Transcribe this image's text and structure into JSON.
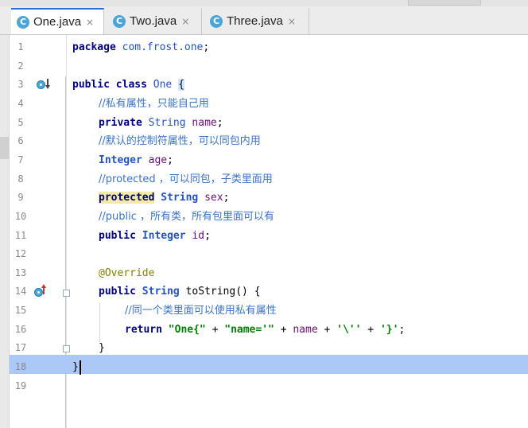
{
  "tabs": [
    {
      "label": "One.java",
      "close": "×"
    },
    {
      "label": "Two.java",
      "close": "×"
    },
    {
      "label": "Three.java",
      "close": "×"
    }
  ],
  "tab_icon_letter": "C",
  "line_numbers": [
    "1",
    "2",
    "3",
    "4",
    "5",
    "6",
    "7",
    "8",
    "9",
    "10",
    "11",
    "12",
    "13",
    "14",
    "15",
    "16",
    "17",
    "18",
    "19"
  ],
  "current_line": "18",
  "code": {
    "l1": {
      "kw": "package",
      "pkg": "com.frost.one",
      "semi": ";"
    },
    "l3": {
      "kw1": "public",
      "kw2": "class",
      "cls": "One",
      "brace": "{"
    },
    "l4": {
      "comment": "//私有属性，只能自己用"
    },
    "l5": {
      "kw": "private",
      "type": "String",
      "field": "name",
      "semi": ";"
    },
    "l6": {
      "comment": "//默认的控制符属性，可以同包内用"
    },
    "l7": {
      "type": "Integer",
      "field": "age",
      "semi": ";"
    },
    "l8": {
      "comment": "//protected ，可以同包，子类里面用"
    },
    "l9": {
      "kw": "protected",
      "type": "String",
      "field": "sex",
      "semi": ";"
    },
    "l10": {
      "comment": "//public ，所有类，所有包里面可以有"
    },
    "l11": {
      "kw": "public",
      "type": "Integer",
      "field": "id",
      "semi": ";"
    },
    "l13": {
      "annotation": "@Override"
    },
    "l14": {
      "kw": "public",
      "type": "String",
      "method": "toString()",
      "brace": "{"
    },
    "l15": {
      "comment": "//同一个类里面可以使用私有属性"
    },
    "l16": {
      "kw": "return",
      "s1": "\"One{\"",
      "plus1": " + ",
      "s2": "\"name='\"",
      "plus2": " + ",
      "field": "name",
      "plus3": " + ",
      "s3": "'\\''",
      "plus4": " + ",
      "s4": "'}'",
      "semi": ";"
    },
    "l17": {
      "brace": "}"
    },
    "l18": {
      "brace": "}"
    }
  }
}
